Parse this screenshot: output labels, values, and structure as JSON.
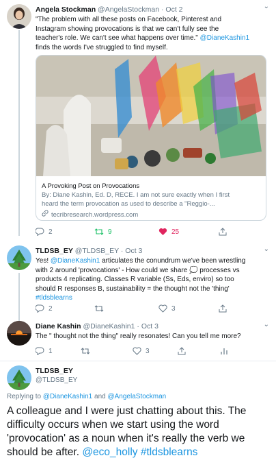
{
  "tweet1": {
    "name": "Angela Stockman",
    "handle": "@AngelaStockman",
    "time": "Oct 2",
    "text_line1": "\"The problem with all these posts on Facebook, Pinterest and",
    "text_line2": "Instagram showing provocations is that we can't fully see the",
    "text_line3_plain": "teacher's role. We can't see what happens over time.\"",
    "text_line3_link": "@DianeKashin1",
    "text_line4": "finds the words I've struggled to find myself.",
    "card": {
      "title": "A Provoking Post on Provocations",
      "desc_line1": "By: Diane Kashin, Ed. D, RECE. I am not sure exactly when I first",
      "desc_line2": "heard the term provocation as used to describe a \"Reggio-...",
      "domain": "tecribresearch.wordpress.com"
    },
    "replies": "2",
    "retweets": "9",
    "likes": "25"
  },
  "tweet2": {
    "name": "TLDSB_EY",
    "handle": "@TLDSB_EY",
    "time": "Oct 3",
    "line1_plain": "Yes!",
    "line1_link": "@DianeKashin1",
    "line1_rest": "articulates the conundrum we've been wrestling",
    "line2": "with 2 around 'provocations' - How could we share 💭 processes vs",
    "line3": "products 4 replicating. Classes R variable (Ss, Eds, enviro) so too",
    "line4": "should R responses B, sustainability = the thought not the 'thing'",
    "hashtag": "#tldsblearns",
    "replies": "2",
    "likes": "3"
  },
  "tweet3": {
    "name": "Diane Kashin",
    "handle": "@DianeKashin1",
    "time": "Oct 3",
    "text": "The \" thought not the thing\" really resonates! Can you tell me more?",
    "replies": "1",
    "likes": "3"
  },
  "main": {
    "name": "TLDSB_EY",
    "handle": "@TLDSB_EY",
    "replying_label": "Replying to",
    "replying_user1": "@DianeKashin1",
    "replying_and": "and",
    "replying_user2": "@AngelaStockman",
    "line1": "A colleague and I were just chatting about this. The",
    "line2": "difficulty occurs when we start using the word",
    "line3": "'provocation' as a noun when it's really the verb we",
    "line4_plain": "should be after.",
    "line4_link1": "@eco_holly",
    "line4_link2": "#tldsblearns"
  },
  "colors": {
    "link": "#1b95e0",
    "like": "#e0245e",
    "retweet": "#17bf63",
    "muted": "#657786"
  }
}
